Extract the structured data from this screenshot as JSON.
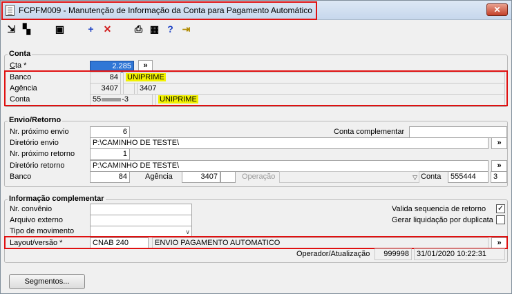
{
  "window": {
    "title": "FCPFM009 - Manutenção de Informação da Conta para Pagamento Automático",
    "close_glyph": "✕"
  },
  "toolbar": [
    {
      "name": "export-icon",
      "glyph": "⇲"
    },
    {
      "name": "copy-icon",
      "glyph": "▚"
    },
    {
      "name": "save-icon",
      "glyph": "▣"
    },
    {
      "name": "add-icon",
      "glyph": "+"
    },
    {
      "name": "delete-icon",
      "glyph": "✕"
    },
    {
      "name": "print-icon",
      "glyph": "⎙"
    },
    {
      "name": "calculator-icon",
      "glyph": "▦"
    },
    {
      "name": "help-icon",
      "glyph": "?"
    },
    {
      "name": "exit-icon",
      "glyph": "⇥"
    }
  ],
  "conta": {
    "title": "Conta",
    "cta_label": "Cta *",
    "cta_value": "2.285",
    "lookup": "»",
    "banco_label": "Banco",
    "banco_num": "84",
    "banco_name": "UNIPRIME",
    "agencia_label": "Agência",
    "agencia_num": "3407",
    "agencia_dv": "",
    "agencia_code": "3407",
    "conta_label": "Conta",
    "conta_prefix": "55",
    "conta_suffix": "-3",
    "conta_name": "UNIPRIME"
  },
  "envio": {
    "title": "Envio/Retorno",
    "prox_envio_label": "Nr. próximo envio",
    "prox_envio": "6",
    "conta_compl_label": "Conta complementar",
    "conta_compl": "",
    "dir_envio_label": "Diretório envio",
    "dir_envio": "P:\\CAMINHO DE TESTE\\",
    "prox_retorno_label": "Nr. próximo retorno",
    "prox_retorno": "1",
    "dir_retorno_label": "Diretório retorno",
    "dir_retorno": "P:\\CAMINHO DE TESTE\\",
    "banco_label": "Banco",
    "banco": "84",
    "agencia_label": "Agência",
    "agencia": "3407",
    "operacao_label": "Operação",
    "conta_label": "Conta",
    "conta": "555444",
    "conta_dv": "3",
    "btn": "»"
  },
  "info": {
    "title": "Informação complementar",
    "convenio_label": "Nr. convênio",
    "arquivo_label": "Arquivo externo",
    "tipo_label": "Tipo de movimento",
    "layout_label": "Layout/versão *",
    "layout_code": "CNAB 240",
    "layout_desc": "ENVIO PAGAMENTO AUTOMATICO",
    "valida_label": "Valida sequencia de retorno",
    "valida_check": "✓",
    "gerar_label": "Gerar liquidação por duplicata",
    "btn": "»"
  },
  "footer": {
    "operador_label": "Operador/Atualização",
    "operador": "999998",
    "atualizacao": "31/01/2020 10:22:31",
    "segmentos": "Segmentos..."
  }
}
